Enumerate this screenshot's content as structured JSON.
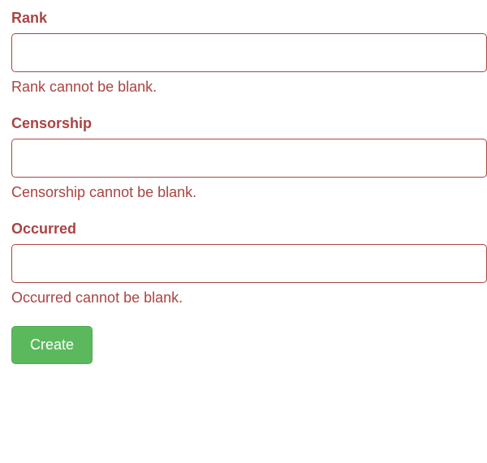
{
  "form": {
    "fields": [
      {
        "label": "Rank",
        "value": "",
        "error": "Rank cannot be blank."
      },
      {
        "label": "Censorship",
        "value": "",
        "error": "Censorship cannot be blank."
      },
      {
        "label": "Occurred",
        "value": "",
        "error": "Occurred cannot be blank."
      }
    ],
    "submit_label": "Create"
  },
  "colors": {
    "error": "#a94442",
    "button_bg": "#5cb85c",
    "button_border": "#4cae4c"
  }
}
